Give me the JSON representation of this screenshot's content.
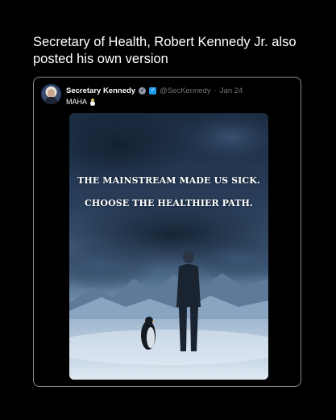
{
  "headline": "Secretary of Health, Robert Kennedy Jr. also posted his own version",
  "post": {
    "author_name": "Secretary Kennedy",
    "verified_icon": "verified-badge-icon",
    "gov_icon": "government-badge-icon",
    "handle": "@SecKennedy",
    "separator": "·",
    "date": "Jan 24",
    "text": "MAHA",
    "text_emoji": "ice-cream-icon",
    "image": {
      "line1": "THE MAINSTREAM MADE US SICK.",
      "line2": "CHOOSE THE HEALTHIER PATH."
    }
  },
  "colors": {
    "background": "#000000",
    "border": "#8a8a8a",
    "muted_text": "#71767b",
    "badge_blue": "#1d9bf0"
  }
}
